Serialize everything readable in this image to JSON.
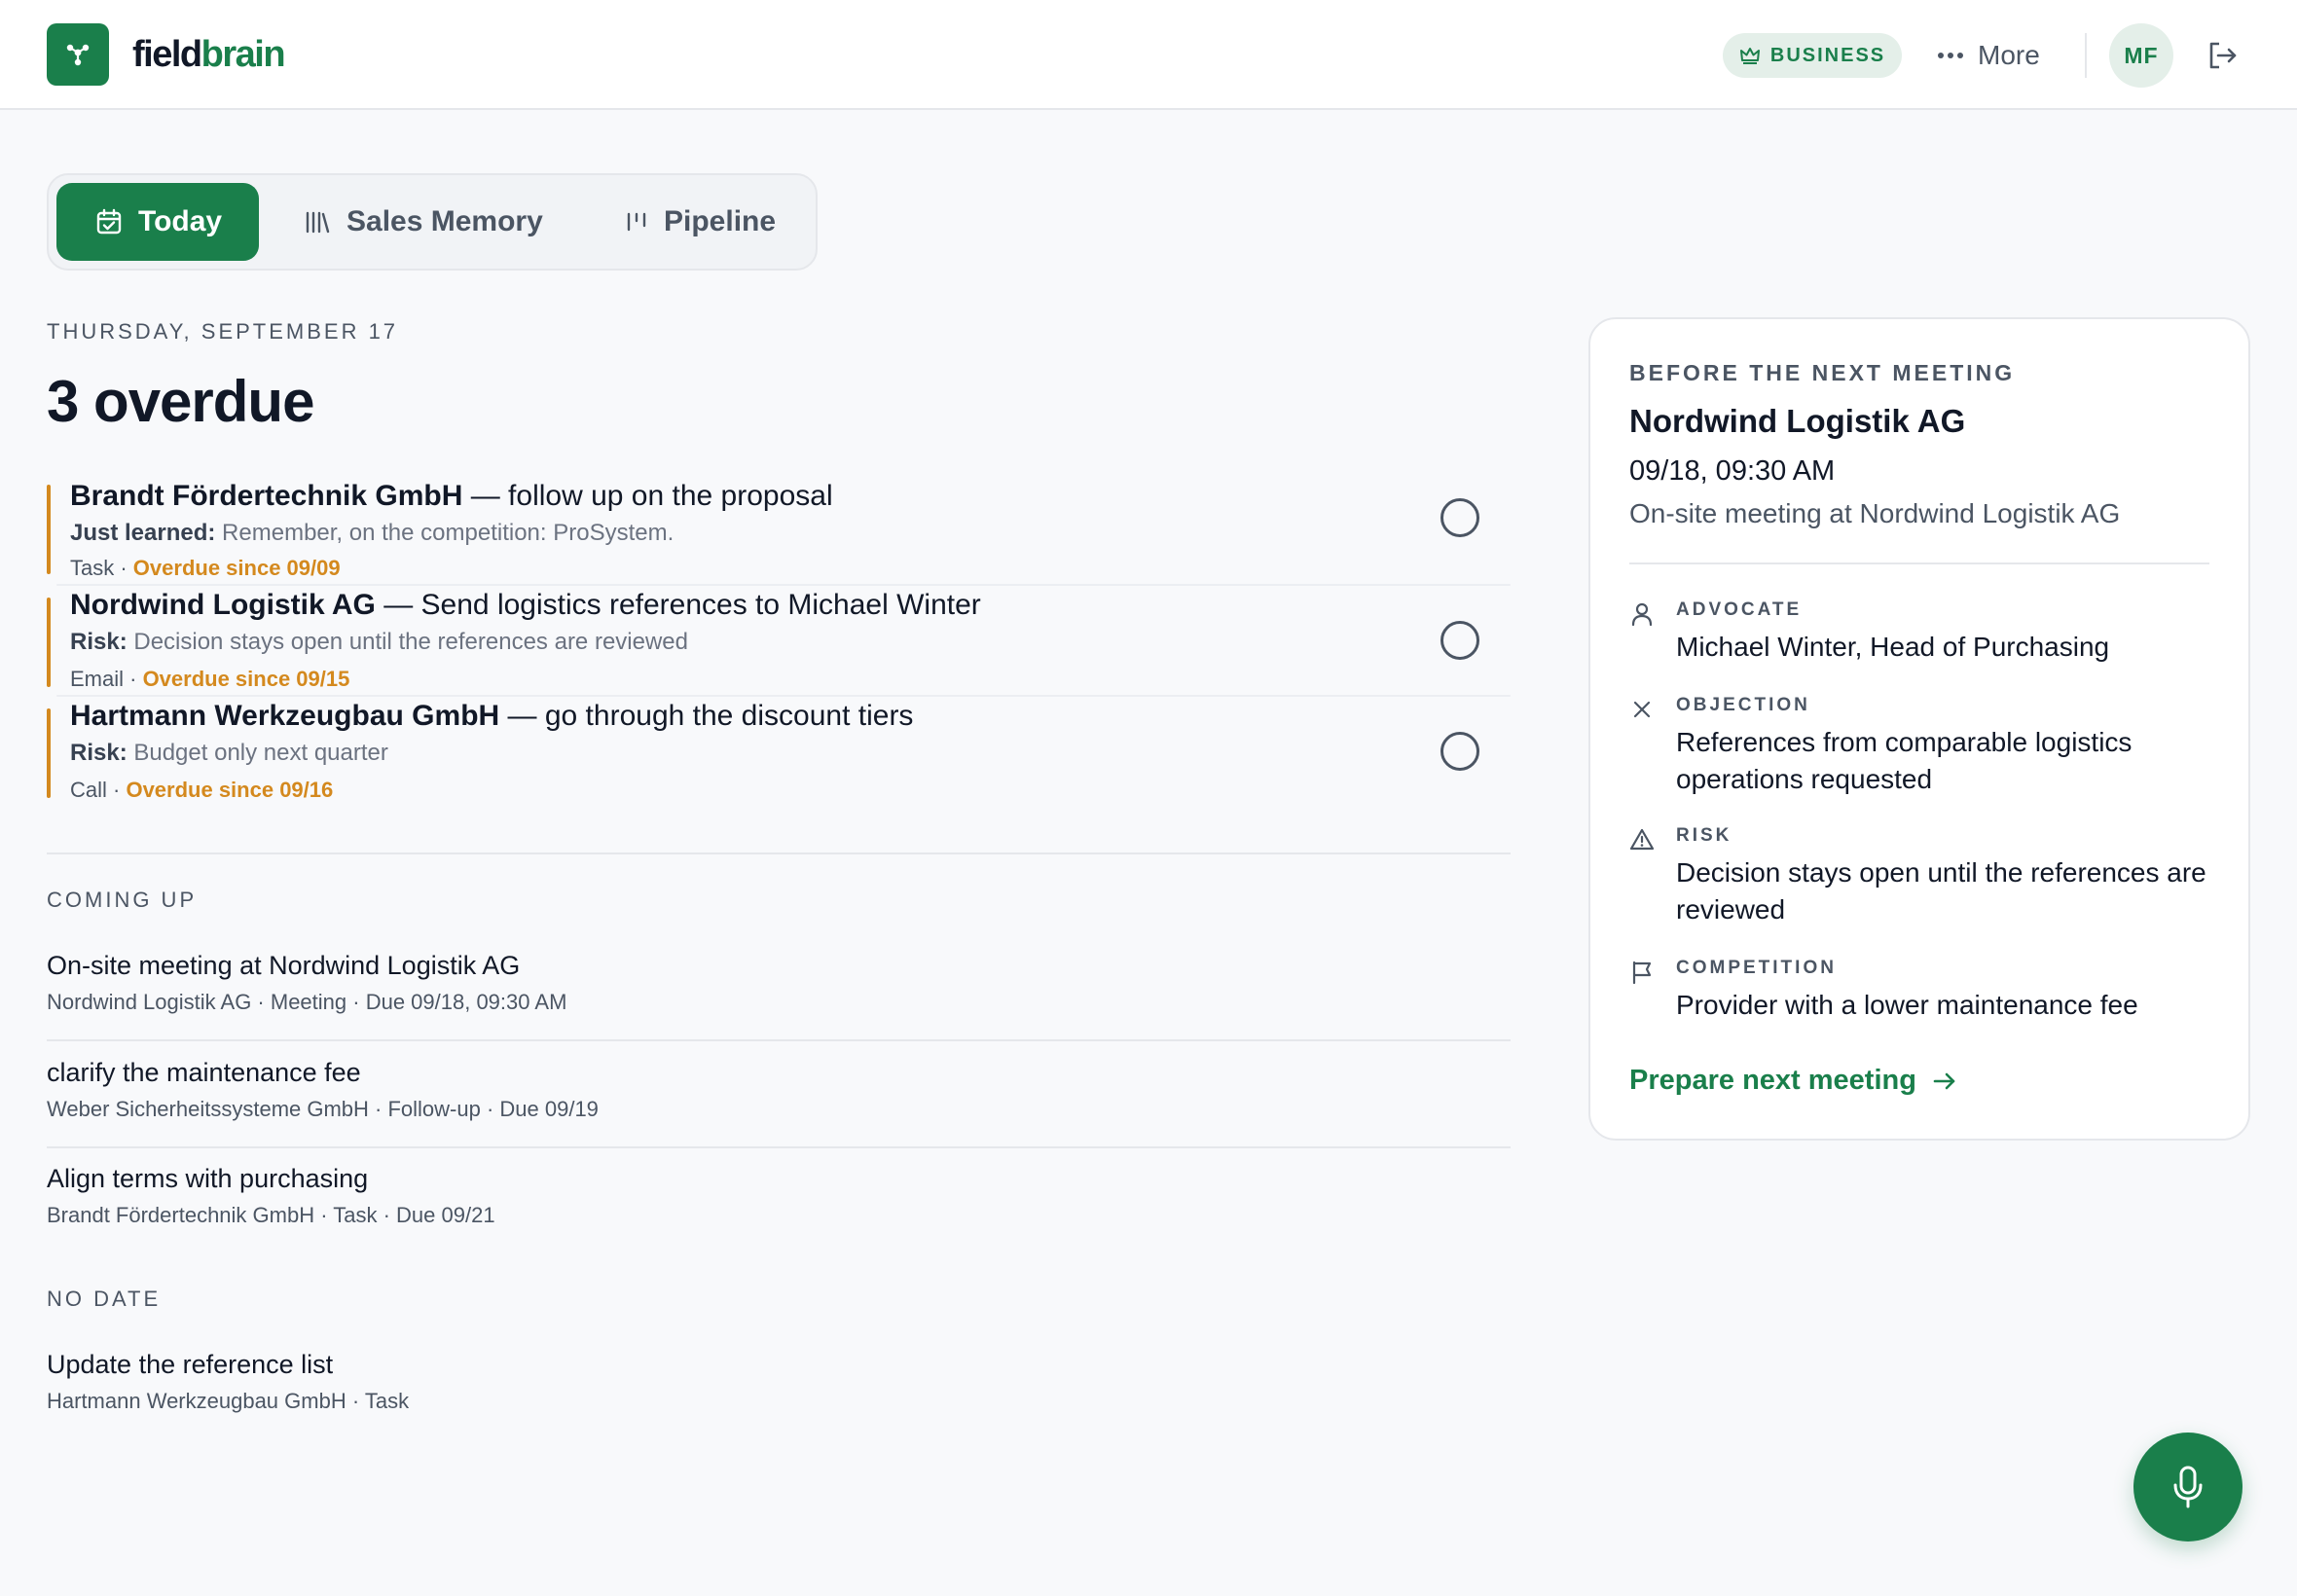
{
  "brand": {
    "part1": "field",
    "part2": "brain"
  },
  "header": {
    "plan_badge": "BUSINESS",
    "more_label": "More",
    "avatar_initials": "MF"
  },
  "tabs": [
    {
      "label": "Today",
      "active": true
    },
    {
      "label": "Sales Memory",
      "active": false
    },
    {
      "label": "Pipeline",
      "active": false
    }
  ],
  "today": {
    "date_label": "THURSDAY, SEPTEMBER 17",
    "headline": "3 overdue"
  },
  "overdue": [
    {
      "company": "Brandt Fördertechnik GmbH",
      "action": " — follow up on the proposal",
      "note_label": "Just learned:",
      "note_text": " Remember, on the competition: ProSystem.",
      "type": "Task · ",
      "overdue": "Overdue since 09/09"
    },
    {
      "company": "Nordwind Logistik AG",
      "action": " — Send logistics references to Michael Winter",
      "note_label": "Risk:",
      "note_text": " Decision stays open until the references are reviewed",
      "type": "Email · ",
      "overdue": "Overdue since 09/15"
    },
    {
      "company": "Hartmann Werkzeugbau GmbH",
      "action": " — go through the discount tiers",
      "note_label": "Risk:",
      "note_text": " Budget only next quarter",
      "type": "Call · ",
      "overdue": "Overdue since 09/16"
    }
  ],
  "coming_up": {
    "label": "COMING UP",
    "items": [
      {
        "title": "On-site meeting at Nordwind Logistik AG",
        "meta": "Nordwind Logistik AG · Meeting · Due 09/18, 09:30 AM"
      },
      {
        "title": "clarify the maintenance fee",
        "meta": "Weber Sicherheitssysteme GmbH · Follow-up · Due 09/19"
      },
      {
        "title": "Align terms with purchasing",
        "meta": "Brandt Fördertechnik GmbH · Task · Due 09/21"
      }
    ]
  },
  "no_date": {
    "label": "NO DATE",
    "items": [
      {
        "title": "Update the reference list",
        "meta": "Hartmann Werkzeugbau GmbH · Task"
      }
    ]
  },
  "next_meeting": {
    "eyebrow": "BEFORE THE NEXT MEETING",
    "company": "Nordwind Logistik AG",
    "when": "09/18, 09:30 AM",
    "what": "On-site meeting at Nordwind Logistik AG",
    "facts": [
      {
        "label": "ADVOCATE",
        "value": "Michael Winter, Head of Purchasing",
        "icon": "person-icon"
      },
      {
        "label": "OBJECTION",
        "value": "References from comparable logistics operations requested",
        "icon": "x-icon"
      },
      {
        "label": "RISK",
        "value": "Decision stays open until the references are reviewed",
        "icon": "warning-icon"
      },
      {
        "label": "COMPETITION",
        "value": "Provider with a lower maintenance fee",
        "icon": "flag-icon"
      }
    ],
    "cta": "Prepare next meeting"
  },
  "colors": {
    "brand_green": "#1a7f4b",
    "overdue_amber": "#d4891e",
    "badge_bg": "#e4efe9"
  }
}
